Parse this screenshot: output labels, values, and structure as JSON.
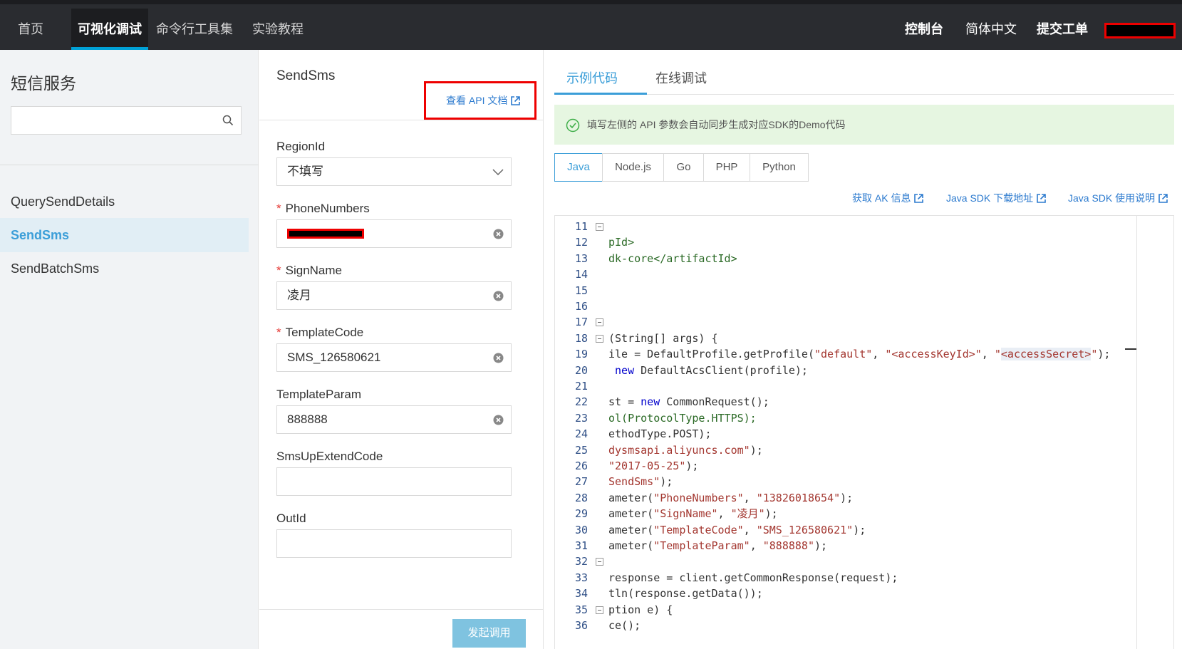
{
  "nav": {
    "tabs": [
      "首页",
      "可视化调试",
      "命令行工具集",
      "实验教程"
    ],
    "active_tab": "可视化调试",
    "right": [
      "控制台",
      "简体中文",
      "提交工单"
    ]
  },
  "sidebar": {
    "title": "短信服务",
    "search_placeholder": "",
    "items": [
      "QuerySendDetails",
      "SendSms",
      "SendBatchSms"
    ],
    "active_item": "SendSms"
  },
  "form": {
    "api_name": "SendSms",
    "api_doc_link": "查看 API 文档",
    "fields": [
      {
        "label": "RegionId",
        "required": false,
        "value": "不填写",
        "type": "select"
      },
      {
        "label": "PhoneNumbers",
        "required": true,
        "value": "",
        "type": "text"
      },
      {
        "label": "SignName",
        "required": true,
        "value": "凌月",
        "type": "text"
      },
      {
        "label": "TemplateCode",
        "required": true,
        "value": "SMS_126580621",
        "type": "text"
      },
      {
        "label": "TemplateParam",
        "required": false,
        "value": "888888",
        "type": "text"
      },
      {
        "label": "SmsUpExtendCode",
        "required": false,
        "value": "",
        "type": "text"
      },
      {
        "label": "OutId",
        "required": false,
        "value": "",
        "type": "text"
      }
    ],
    "required_mark": "*",
    "submit_label": "发起调用"
  },
  "code_panel": {
    "tabs": [
      "示例代码",
      "在线调试"
    ],
    "active_tab": "示例代码",
    "notice": "填写左侧的 API 参数会自动同步生成对应SDK的Demo代码",
    "languages": [
      "Java",
      "Node.js",
      "Go",
      "PHP",
      "Python"
    ],
    "active_language": "Java",
    "links": [
      "获取 AK 信息",
      "Java SDK 下载地址",
      "Java SDK 使用说明"
    ],
    "lines": [
      {
        "n": "11",
        "fold": true,
        "parts": []
      },
      {
        "n": "12",
        "fold": false,
        "parts": [
          {
            "t": "pId>",
            "c": "grn"
          }
        ]
      },
      {
        "n": "13",
        "fold": false,
        "parts": [
          {
            "t": "dk-core</artifactId>",
            "c": "grn"
          }
        ]
      },
      {
        "n": "14",
        "fold": false,
        "parts": []
      },
      {
        "n": "15",
        "fold": false,
        "parts": []
      },
      {
        "n": "16",
        "fold": false,
        "parts": []
      },
      {
        "n": "17",
        "fold": true,
        "parts": []
      },
      {
        "n": "18",
        "fold": true,
        "parts": [
          {
            "t": "(String[] args) {",
            "c": ""
          }
        ]
      },
      {
        "n": "19",
        "fold": false,
        "parts": [
          {
            "t": "ile = DefaultProfile.getProfile(",
            "c": ""
          },
          {
            "t": "\"default\"",
            "c": "str"
          },
          {
            "t": ", ",
            "c": ""
          },
          {
            "t": "\"<accessKeyId>\"",
            "c": "str"
          },
          {
            "t": ", ",
            "c": ""
          },
          {
            "t": "\"",
            "c": "str"
          },
          {
            "t": "<accessSecret>",
            "c": "strhl"
          },
          {
            "t": "\"",
            "c": "str"
          },
          {
            "t": ");",
            "c": ""
          }
        ]
      },
      {
        "n": "20",
        "fold": false,
        "parts": [
          {
            "t": " ",
            "c": ""
          },
          {
            "t": "new",
            "c": "kw"
          },
          {
            "t": " DefaultAcsClient(profile);",
            "c": ""
          }
        ]
      },
      {
        "n": "21",
        "fold": false,
        "parts": []
      },
      {
        "n": "22",
        "fold": false,
        "parts": [
          {
            "t": "st = ",
            "c": ""
          },
          {
            "t": "new",
            "c": "kw"
          },
          {
            "t": " CommonRequest();",
            "c": ""
          }
        ]
      },
      {
        "n": "23",
        "fold": false,
        "parts": [
          {
            "t": "ol(ProtocolType.HTTPS);",
            "c": "grn"
          }
        ]
      },
      {
        "n": "24",
        "fold": false,
        "parts": [
          {
            "t": "ethodType.POST);",
            "c": ""
          }
        ]
      },
      {
        "n": "25",
        "fold": false,
        "parts": [
          {
            "t": "dysmsapi.aliyuncs.com\"",
            "c": "str"
          },
          {
            "t": ");",
            "c": ""
          }
        ]
      },
      {
        "n": "26",
        "fold": false,
        "parts": [
          {
            "t": "\"2017-05-25\"",
            "c": "str"
          },
          {
            "t": ");",
            "c": ""
          }
        ]
      },
      {
        "n": "27",
        "fold": false,
        "parts": [
          {
            "t": "SendSms\"",
            "c": "str"
          },
          {
            "t": ");",
            "c": ""
          }
        ]
      },
      {
        "n": "28",
        "fold": false,
        "parts": [
          {
            "t": "ameter(",
            "c": ""
          },
          {
            "t": "\"PhoneNumbers\"",
            "c": "str"
          },
          {
            "t": ", ",
            "c": ""
          },
          {
            "t": "\"13826018654\"",
            "c": "str"
          },
          {
            "t": ");",
            "c": ""
          }
        ]
      },
      {
        "n": "29",
        "fold": false,
        "parts": [
          {
            "t": "ameter(",
            "c": ""
          },
          {
            "t": "\"SignName\"",
            "c": "str"
          },
          {
            "t": ", ",
            "c": ""
          },
          {
            "t": "\"凌月\"",
            "c": "str"
          },
          {
            "t": ");",
            "c": ""
          }
        ]
      },
      {
        "n": "30",
        "fold": false,
        "parts": [
          {
            "t": "ameter(",
            "c": ""
          },
          {
            "t": "\"TemplateCode\"",
            "c": "str"
          },
          {
            "t": ", ",
            "c": ""
          },
          {
            "t": "\"SMS_126580621\"",
            "c": "str"
          },
          {
            "t": ");",
            "c": ""
          }
        ]
      },
      {
        "n": "31",
        "fold": false,
        "parts": [
          {
            "t": "ameter(",
            "c": ""
          },
          {
            "t": "\"TemplateParam\"",
            "c": "str"
          },
          {
            "t": ", ",
            "c": ""
          },
          {
            "t": "\"888888\"",
            "c": "str"
          },
          {
            "t": ");",
            "c": ""
          }
        ]
      },
      {
        "n": "32",
        "fold": true,
        "parts": []
      },
      {
        "n": "33",
        "fold": false,
        "parts": [
          {
            "t": "response = client.getCommonResponse(request);",
            "c": ""
          }
        ]
      },
      {
        "n": "34",
        "fold": false,
        "parts": [
          {
            "t": "tln(response.getData());",
            "c": ""
          }
        ]
      },
      {
        "n": "35",
        "fold": true,
        "parts": [
          {
            "t": "ption e) {",
            "c": ""
          }
        ]
      },
      {
        "n": "36",
        "fold": false,
        "parts": [
          {
            "t": "ce();",
            "c": ""
          }
        ]
      }
    ]
  },
  "colors": {
    "accent": "#3b9ed8",
    "topbar": "#2a2c30",
    "link": "#2d7bcf",
    "required": "#e53935",
    "notice_bg": "#e6f6e1",
    "redaction_border": "#e00000"
  },
  "icons": [
    "search-icon",
    "external-link-icon",
    "chevron-down-icon",
    "clear-icon",
    "check-circle-icon",
    "fold-icon"
  ]
}
